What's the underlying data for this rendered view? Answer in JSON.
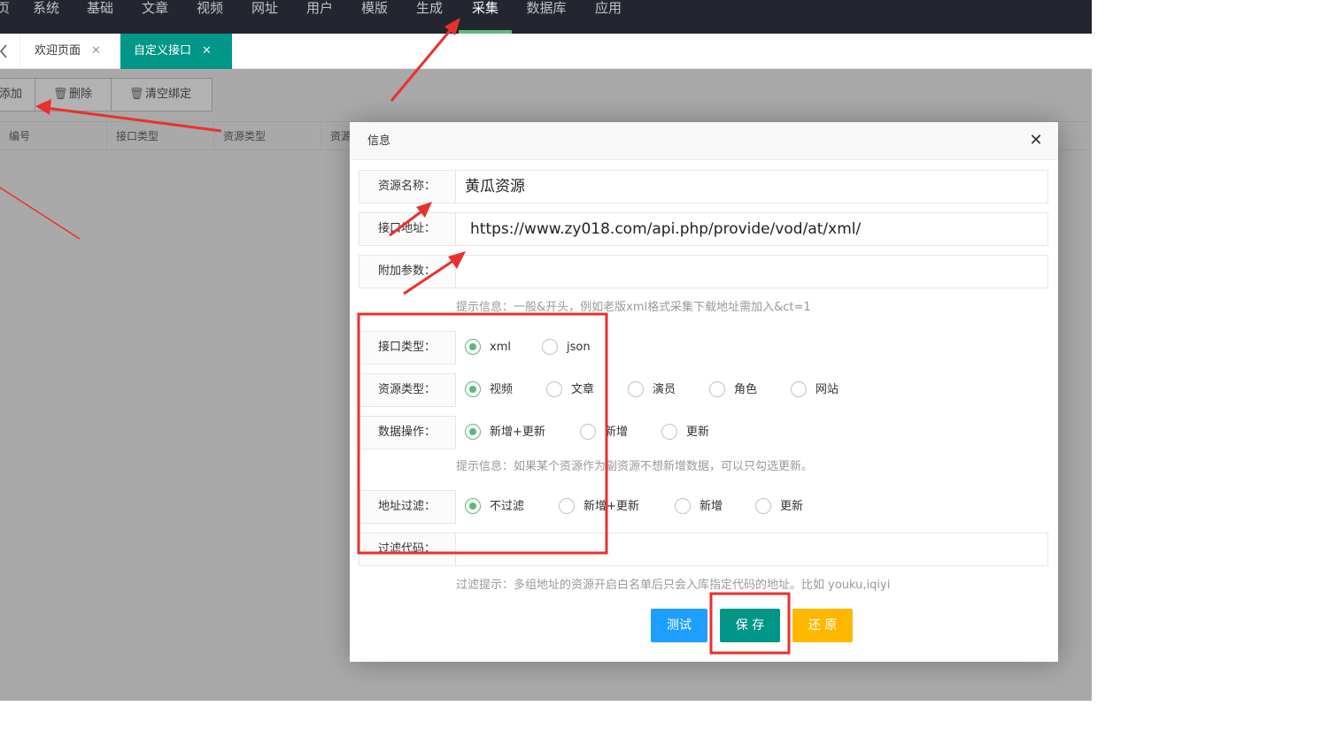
{
  "nav": {
    "items": [
      {
        "label": "页"
      },
      {
        "label": "系统"
      },
      {
        "label": "基础"
      },
      {
        "label": "文章"
      },
      {
        "label": "视频"
      },
      {
        "label": "网址"
      },
      {
        "label": "用户"
      },
      {
        "label": "模版"
      },
      {
        "label": "生成"
      },
      {
        "label": "采集"
      },
      {
        "label": "数据库"
      },
      {
        "label": "应用"
      }
    ],
    "active": "采集"
  },
  "tabs": [
    {
      "label": "欢迎页面",
      "close": "✕"
    },
    {
      "label": "自定义接口",
      "close": "✕"
    }
  ],
  "toolbar": {
    "add_label": "添加",
    "delete_label": "删除",
    "clear_label": "清空绑定"
  },
  "table": {
    "headers": [
      "编号",
      "接口类型",
      "资源类型",
      "资源"
    ]
  },
  "dialog": {
    "title": "信息",
    "close": "✕",
    "name_label": "资源名称：",
    "name_value": "黄瓜资源",
    "url_label": "接口地址：",
    "url_value": "https://www.zy018.com/api.php/provide/vod/at/xml/",
    "param_label": "附加参数：",
    "param_value": "",
    "param_hint": "提示信息：一般&开头，例如老版xml格式采集下载地址需加入&ct=1",
    "api_type_label": "接口类型：",
    "api_types": [
      "xml",
      "json"
    ],
    "res_type_label": "资源类型：",
    "res_types": [
      "视频",
      "文章",
      "演员",
      "角色",
      "网站"
    ],
    "data_op_label": "数据操作：",
    "data_ops": [
      "新增+更新",
      "新增",
      "更新"
    ],
    "data_op_hint": "提示信息：如果某个资源作为副资源不想新增数据，可以只勾选更新。",
    "filter_label": "地址过滤：",
    "filters": [
      "不过滤",
      "新增+更新",
      "新增",
      "更新"
    ],
    "filter_code_label": "过滤代码：",
    "filter_code_value": "",
    "filter_hint": "过滤提示：多组地址的资源开启白名单后只会入库指定代码的地址。比如 youku,iqiyi",
    "test_label": "测试",
    "save_label": "保 存",
    "reset_label": "还 原"
  },
  "colors": {
    "nav_bg": "#23262e",
    "nav_active_bar": "#5fb878",
    "tab_active": "#009688",
    "radio_checked": "#5fb878",
    "btn_test": "#1e9fff",
    "btn_save": "#009688",
    "btn_reset": "#ffb800",
    "annotation": "#e8312f"
  }
}
